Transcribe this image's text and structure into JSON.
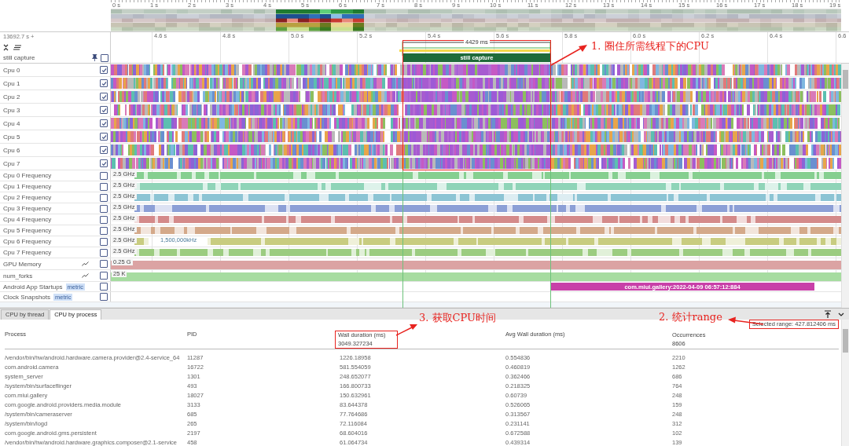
{
  "overview": {
    "ticks": [
      "0 s",
      "1 s",
      "2 s",
      "3 s",
      "4 s",
      "5 s",
      "6 s",
      "7 s",
      "8 s",
      "9 s",
      "10 s",
      "11 s",
      "12 s",
      "13 s",
      "14 s",
      "15 s",
      "16 s",
      "17 s",
      "18 s",
      "19 s"
    ]
  },
  "timeline": {
    "offset": "13692.7 s +",
    "ticks": [
      "4.6 s",
      "4.8 s",
      "5.0 s",
      "5.2 s",
      "5.4 s",
      "5.6 s",
      "5.8 s",
      "6.0 s",
      "6.2 s",
      "6.4 s",
      "6.6"
    ],
    "selection_duration": "4429 ms"
  },
  "pinned_track": {
    "label": "still capture",
    "pinned": true,
    "checked": false,
    "slice": "still capture"
  },
  "tracks": [
    {
      "kind": "cpu",
      "label": "Cpu 0",
      "checked": true
    },
    {
      "kind": "cpu",
      "label": "Cpu 1",
      "checked": true
    },
    {
      "kind": "cpu",
      "label": "Cpu 2",
      "checked": true
    },
    {
      "kind": "cpu",
      "label": "Cpu 3",
      "checked": true
    },
    {
      "kind": "cpu",
      "label": "Cpu 4",
      "checked": true
    },
    {
      "kind": "cpu",
      "label": "Cpu 5",
      "checked": true
    },
    {
      "kind": "cpu",
      "label": "Cpu 6",
      "checked": true
    },
    {
      "kind": "cpu",
      "label": "Cpu 7",
      "checked": true
    },
    {
      "kind": "freq",
      "label": "Cpu 0 Frequency",
      "checked": false,
      "value": "2.5 GHz",
      "color": "#86cf90"
    },
    {
      "kind": "freq",
      "label": "Cpu 1 Frequency",
      "checked": false,
      "value": "2.5 GHz",
      "color": "#8fd4b8"
    },
    {
      "kind": "freq",
      "label": "Cpu 2 Frequency",
      "checked": false,
      "value": "2.5 GHz",
      "color": "#8cc4d4"
    },
    {
      "kind": "freq",
      "label": "Cpu 3 Frequency",
      "checked": false,
      "value": "2.5 GHz",
      "color": "#8c9fd6"
    },
    {
      "kind": "freq",
      "label": "Cpu 4 Frequency",
      "checked": false,
      "value": "2.5 GHz",
      "color": "#d48a8a"
    },
    {
      "kind": "freq",
      "label": "Cpu 5 Frequency",
      "checked": false,
      "value": "2.5 GHz",
      "color": "#d4a98a"
    },
    {
      "kind": "freq",
      "label": "Cpu 6 Frequency",
      "checked": false,
      "value": "2.5 GHz",
      "color": "#c8cc80",
      "tooltip": "1,500,000kHz"
    },
    {
      "kind": "freq",
      "label": "Cpu 7 Frequency",
      "checked": false,
      "value": "2.5 GHz",
      "color": "#9ccc80"
    },
    {
      "kind": "counter",
      "label": "GPU Memory",
      "checked": false,
      "value": "0.25 G",
      "color": "#dba3a3"
    },
    {
      "kind": "counter",
      "label": "num_forks",
      "checked": false,
      "value": "25 K",
      "color": "#a6dca0"
    },
    {
      "kind": "slices",
      "label": "Android App Startups",
      "badge": "metric",
      "checked": false,
      "slice": "com.miui.gallery:2022-04-09 06:57:12:884"
    },
    {
      "kind": "slices",
      "label": "Clock Snapshots",
      "badge": "metric",
      "checked": false
    }
  ],
  "bottom_panel": {
    "tabs": [
      {
        "label": "CPU by thread",
        "selected": false
      },
      {
        "label": "CPU by process",
        "selected": true
      }
    ],
    "selected_range": "Selected range: 427.812406 ms",
    "columns": [
      {
        "label": "Process"
      },
      {
        "label": "PID"
      },
      {
        "label": "Wall duration (ms)",
        "total": "3049.327234"
      },
      {
        "label": "Avg Wall duration (ms)"
      },
      {
        "label": "Occurrences",
        "total": "8606"
      }
    ],
    "rows": [
      [
        "/vendor/bin/hw/android.hardware.camera.provider@2.4-service_64",
        "11287",
        "1226.18958",
        "0.554836",
        "2210"
      ],
      [
        "com.android.camera",
        "16722",
        "581.554059",
        "0.460819",
        "1262"
      ],
      [
        "system_server",
        "1301",
        "248.652077",
        "0.362466",
        "686"
      ],
      [
        "/system/bin/surfaceflinger",
        "493",
        "166.800733",
        "0.218325",
        "764"
      ],
      [
        "com.miui.gallery",
        "18027",
        "150.632961",
        "0.60739",
        "248"
      ],
      [
        "com.google.android.providers.media.module",
        "3133",
        "83.644378",
        "0.526065",
        "159"
      ],
      [
        "/system/bin/cameraserver",
        "685",
        "77.764686",
        "0.313567",
        "248"
      ],
      [
        "/system/bin/logd",
        "265",
        "72.116084",
        "0.231141",
        "312"
      ],
      [
        "com.google.android.gms.persistent",
        "2197",
        "68.604016",
        "0.672588",
        "102"
      ],
      [
        "/vendor/bin/hw/android.hardware.graphics.composer@2.1-service",
        "458",
        "61.064734",
        "0.439314",
        "139"
      ]
    ]
  },
  "annotations": [
    {
      "text": "1. 圈住所需线程下的CPU"
    },
    {
      "text": "3. 获取CPU时间"
    },
    {
      "text": "2. 统计range"
    }
  ]
}
